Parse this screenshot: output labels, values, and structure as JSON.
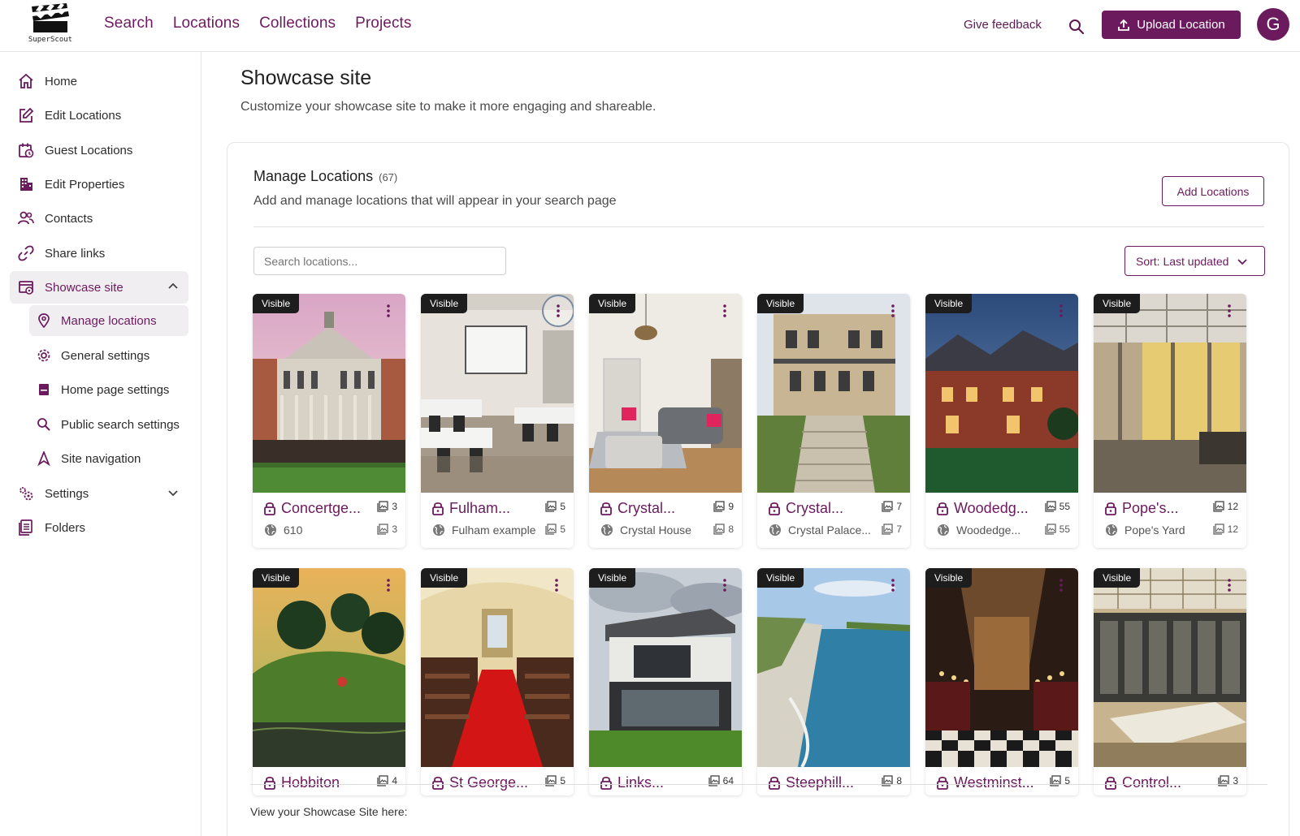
{
  "brand": {
    "name": "SuperScout"
  },
  "nav": {
    "items": [
      "Search",
      "Locations",
      "Collections",
      "Projects"
    ]
  },
  "topbar": {
    "feedback": "Give feedback",
    "upload": "Upload Location",
    "avatar": "G"
  },
  "sidebar": {
    "items": [
      {
        "label": "Home",
        "icon": "home-icon"
      },
      {
        "label": "Edit Locations",
        "icon": "edit-icon"
      },
      {
        "label": "Guest Locations",
        "icon": "calendar-clock-icon"
      },
      {
        "label": "Edit Properties",
        "icon": "building-icon"
      },
      {
        "label": "Contacts",
        "icon": "contacts-icon"
      },
      {
        "label": "Share links",
        "icon": "link-icon"
      },
      {
        "label": "Showcase site",
        "icon": "showcase-icon"
      },
      {
        "label": "Settings",
        "icon": "settings-icon"
      },
      {
        "label": "Folders",
        "icon": "folders-icon"
      }
    ],
    "sub_items": [
      {
        "label": "Manage locations",
        "icon": "map-pin-icon"
      },
      {
        "label": "General settings",
        "icon": "gear-icon"
      },
      {
        "label": "Home page settings",
        "icon": "page-icon"
      },
      {
        "label": "Public search settings",
        "icon": "search-icon"
      },
      {
        "label": "Site navigation",
        "icon": "navigation-icon"
      }
    ]
  },
  "page": {
    "title": "Showcase site",
    "subtitle": "Customize your showcase site to make it more engaging and shareable."
  },
  "manage": {
    "title": "Manage Locations",
    "count": "(67)",
    "subtitle": "Add and manage locations that will appear in your search page",
    "add_button": "Add Locations",
    "search_placeholder": "Search locations...",
    "sort_label": "Sort: Last updated",
    "footer_text": "View your Showcase Site here:"
  },
  "colors": {
    "accent": "#6b1a5e",
    "badge": "#1d1d1d"
  },
  "cards": [
    {
      "badge": "Visible",
      "name": "Concertge...",
      "count": "3",
      "site": "610",
      "site_count": "3"
    },
    {
      "badge": "Visible",
      "name": "Fulham...",
      "count": "5",
      "site": "Fulham example",
      "site_count": "5"
    },
    {
      "badge": "Visible",
      "name": "Crystal...",
      "count": "9",
      "site": "Crystal House",
      "site_count": "8"
    },
    {
      "badge": "Visible",
      "name": "Crystal...",
      "count": "7",
      "site": "Crystal Palace...",
      "site_count": "7"
    },
    {
      "badge": "Visible",
      "name": "Woodedg...",
      "count": "55",
      "site": "Woodedge...",
      "site_count": "55"
    },
    {
      "badge": "Visible",
      "name": "Pope's...",
      "count": "12",
      "site": "Pope's Yard",
      "site_count": "12"
    },
    {
      "badge": "Visible",
      "name": "Hobbiton",
      "count": "4"
    },
    {
      "badge": "Visible",
      "name": "St George...",
      "count": "5"
    },
    {
      "badge": "Visible",
      "name": "Links...",
      "count": "64"
    },
    {
      "badge": "Visible",
      "name": "Steephill...",
      "count": "8"
    },
    {
      "badge": "Visible",
      "name": "Westminst...",
      "count": "5"
    },
    {
      "badge": "Visible",
      "name": "Control...",
      "count": "3"
    }
  ]
}
